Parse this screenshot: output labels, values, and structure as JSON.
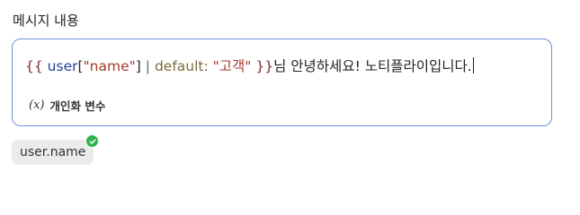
{
  "field": {
    "label": "메시지 내용"
  },
  "editor": {
    "tokens": {
      "open_brace": "{{",
      "var_name": "user",
      "bracket_open": "[",
      "key": "\"name\"",
      "bracket_close": "]",
      "pipe": "|",
      "filter": "default:",
      "default_value": "\"고객\"",
      "close_brace": "}}",
      "trailing_text": "님 안녕하세요! 노티플라이입니다."
    },
    "variable_toggle": {
      "icon_glyph": "(𝑥)",
      "icon_name": "variable-x-icon",
      "label": "개인화 변수"
    }
  },
  "chips": [
    {
      "label": "user.name",
      "status": "valid",
      "status_color": "#2bb24c"
    }
  ],
  "colors": {
    "editor_border": "#6a8fe0",
    "chip_bg": "#ebebeb"
  }
}
